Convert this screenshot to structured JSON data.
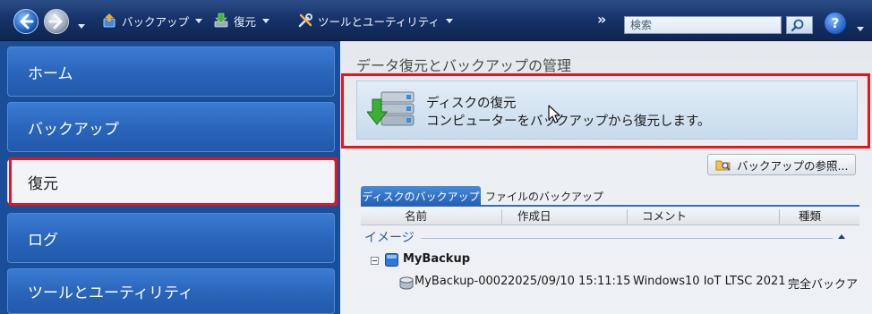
{
  "toolbar": {
    "menus": [
      {
        "label": "バックアップ",
        "icon": "backup-icon"
      },
      {
        "label": "復元",
        "icon": "restore-icon"
      },
      {
        "label": "ツールとユーティリティ",
        "icon": "tools-icon"
      }
    ],
    "overflow_glyph": "»",
    "search": {
      "placeholder": "検索",
      "icon": "search-icon"
    },
    "help": {
      "glyph": "?",
      "icon": "help-icon"
    }
  },
  "sidebar": {
    "items": [
      {
        "label": "ホーム",
        "selected": false
      },
      {
        "label": "バックアップ",
        "selected": false
      },
      {
        "label": "復元",
        "selected": true
      },
      {
        "label": "ログ",
        "selected": false
      },
      {
        "label": "ツールとユーティリティ",
        "selected": false
      }
    ]
  },
  "main": {
    "title": "データ復元とバックアップの管理",
    "task": {
      "title": "ディスクの復元",
      "description": "コンピューターをバックアップから復元します。",
      "icon": "disk-restore-icon"
    },
    "browse_button": {
      "label": "バックアップの参照...",
      "icon": "browse-icon"
    },
    "tabs": [
      {
        "label": "ディスクのバックアップ",
        "selected": true
      },
      {
        "label": "ファイルのバックアップ",
        "selected": false
      }
    ],
    "columns": [
      "名前",
      "作成日",
      "コメント",
      "種類"
    ],
    "group": {
      "label": "イメージ",
      "expanded": true
    },
    "tree": {
      "name": "MyBackup",
      "expanded": true,
      "rows": [
        {
          "name": "MyBackup-0002",
          "created": "2025/09/10 15:11:15",
          "comment": "Windows10 IoT LTSC 2021",
          "type": "完全バックア"
        }
      ]
    }
  },
  "colors": {
    "toolbar": "#0f2550",
    "sidebar": "#2461b4",
    "accent": "#2f6fc4",
    "highlight_box": "#e8141c",
    "selected_item": "#f2f4f7"
  }
}
